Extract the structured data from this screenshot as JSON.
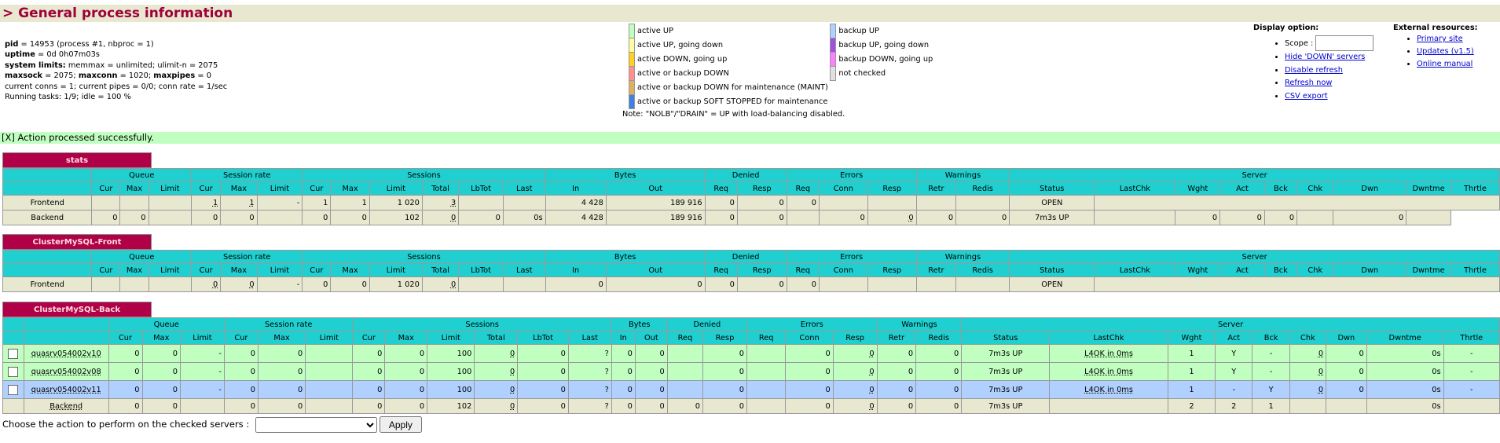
{
  "title": "> General process information",
  "info": {
    "pid_label": "pid",
    "pid_value": " = 14953 (process #1, nbproc = 1)",
    "uptime_label": "uptime",
    "uptime_value": " = 0d 0h07m03s",
    "syslimits_label": "system limits:",
    "syslimits_value": " memmax = unlimited; ulimit-n = 2075",
    "maxsock_label": "maxsock",
    "maxsock_value": " = 2075; ",
    "maxconn_label": "maxconn",
    "maxconn_value": " = 1020; ",
    "maxpipes_label": "maxpipes",
    "maxpipes_value": " = 0",
    "conns": "current conns = 1; current pipes = 0/0; conn rate = 1/sec",
    "tasks": "Running tasks: 1/9; idle = 100 %"
  },
  "legend": {
    "items_left": [
      {
        "color": "#c0ffc0",
        "label": "active UP"
      },
      {
        "color": "#ffffa0",
        "label": "active UP, going down"
      },
      {
        "color": "#ffd020",
        "label": "active DOWN, going up"
      },
      {
        "color": "#ff9090",
        "label": "active or backup DOWN"
      },
      {
        "color": "#e0b060",
        "label": "active or backup DOWN for maintenance (MAINT)"
      },
      {
        "color": "#4080e0",
        "label": "active or backup SOFT STOPPED for maintenance"
      }
    ],
    "items_right": [
      {
        "color": "#b0d0ff",
        "label": "backup UP"
      },
      {
        "color": "#a050e0",
        "label": "backup UP, going down"
      },
      {
        "color": "#ff80ff",
        "label": "backup DOWN, going up"
      },
      {
        "color": "#e0e0e0",
        "label": "not checked"
      }
    ],
    "note": "Note: \"NOLB\"/\"DRAIN\" = UP with load-balancing disabled."
  },
  "display": {
    "title": "Display option:",
    "scope_label": "Scope :",
    "scope_value": "",
    "links": [
      "Hide 'DOWN' servers",
      "Disable refresh",
      "Refresh now",
      "CSV export"
    ]
  },
  "external": {
    "title": "External resources:",
    "links": [
      "Primary site",
      "Updates (v1.5)",
      "Online manual"
    ]
  },
  "success": "[X] Action processed successfully.",
  "headers": {
    "queue": "Queue",
    "session_rate": "Session rate",
    "sessions": "Sessions",
    "bytes": "Bytes",
    "denied": "Denied",
    "errors": "Errors",
    "warnings": "Warnings",
    "server": "Server",
    "cur": "Cur",
    "max": "Max",
    "limit": "Limit",
    "total": "Total",
    "lbtot": "LbTot",
    "last": "Last",
    "in": "In",
    "out": "Out",
    "req": "Req",
    "resp": "Resp",
    "conn": "Conn",
    "retr": "Retr",
    "redis": "Redis",
    "status": "Status",
    "lastchk": "LastChk",
    "wght": "Wght",
    "act": "Act",
    "bck": "Bck",
    "chk": "Chk",
    "dwn": "Dwn",
    "dwntme": "Dwntme",
    "thrtle": "Thrtle"
  },
  "stats": {
    "name": "stats",
    "frontend": {
      "name": "Frontend",
      "sr_cur": "1",
      "sr_max": "1",
      "sr_lim": "-",
      "s_cur": "1",
      "s_max": "1",
      "s_lim": "1 020",
      "s_tot": "3",
      "b_in": "4 428",
      "b_out": "189 916",
      "d_req": "0",
      "d_resp": "0",
      "e_req": "0",
      "status": "OPEN"
    },
    "backend": {
      "name": "Backend",
      "q_cur": "0",
      "q_max": "0",
      "sr_cur": "0",
      "sr_max": "0",
      "s_cur": "0",
      "s_max": "0",
      "s_lim": "102",
      "s_tot": "0",
      "s_lbtot": "0",
      "s_last": "0s",
      "b_in": "4 428",
      "b_out": "189 916",
      "d_req": "0",
      "d_resp": "0",
      "e_conn": "0",
      "e_resp": "0",
      "w_retr": "0",
      "w_redis": "0",
      "status": "7m3s UP",
      "wght": "0",
      "act": "0",
      "bck": "0",
      "dwntme": "0"
    }
  },
  "front": {
    "name": "ClusterMySQL-Front",
    "frontend": {
      "name": "Frontend",
      "sr_cur": "0",
      "sr_max": "0",
      "sr_lim": "-",
      "s_cur": "0",
      "s_max": "0",
      "s_lim": "1 020",
      "s_tot": "0",
      "b_in": "0",
      "b_out": "0",
      "d_req": "0",
      "d_resp": "0",
      "e_req": "0",
      "status": "OPEN"
    }
  },
  "back": {
    "name": "ClusterMySQL-Back",
    "servers": [
      {
        "name": "quasrv054002v10",
        "q_cur": "0",
        "q_max": "0",
        "q_lim": "-",
        "sr_cur": "0",
        "sr_max": "0",
        "s_cur": "0",
        "s_max": "0",
        "s_lim": "100",
        "s_tot": "0",
        "s_lbtot": "0",
        "s_last": "?",
        "b_in": "0",
        "b_out": "0",
        "d_resp": "0",
        "e_conn": "0",
        "e_resp": "0",
        "w_retr": "0",
        "w_redis": "0",
        "status": "7m3s UP",
        "lastchk": "L4OK in 0ms",
        "wght": "1",
        "act": "Y",
        "bck": "-",
        "chk": "0",
        "dwn": "0",
        "dwntme": "0s",
        "thrtle": "-"
      },
      {
        "name": "quasrv054002v08",
        "q_cur": "0",
        "q_max": "0",
        "q_lim": "-",
        "sr_cur": "0",
        "sr_max": "0",
        "s_cur": "0",
        "s_max": "0",
        "s_lim": "100",
        "s_tot": "0",
        "s_lbtot": "0",
        "s_last": "?",
        "b_in": "0",
        "b_out": "0",
        "d_resp": "0",
        "e_conn": "0",
        "e_resp": "0",
        "w_retr": "0",
        "w_redis": "0",
        "status": "7m3s UP",
        "lastchk": "L4OK in 0ms",
        "wght": "1",
        "act": "Y",
        "bck": "-",
        "chk": "0",
        "dwn": "0",
        "dwntme": "0s",
        "thrtle": "-"
      },
      {
        "name": "quasrv054002v11",
        "q_cur": "0",
        "q_max": "0",
        "q_lim": "-",
        "sr_cur": "0",
        "sr_max": "0",
        "s_cur": "0",
        "s_max": "0",
        "s_lim": "100",
        "s_tot": "0",
        "s_lbtot": "0",
        "s_last": "?",
        "b_in": "0",
        "b_out": "0",
        "d_resp": "0",
        "e_conn": "0",
        "e_resp": "0",
        "w_retr": "0",
        "w_redis": "0",
        "status": "7m3s UP",
        "lastchk": "L4OK in 0ms",
        "wght": "1",
        "act": "-",
        "bck": "Y",
        "chk": "0",
        "dwn": "0",
        "dwntme": "0s",
        "thrtle": "-"
      }
    ],
    "backend": {
      "name": "Backend",
      "q_cur": "0",
      "q_max": "0",
      "sr_cur": "0",
      "sr_max": "0",
      "s_cur": "0",
      "s_max": "0",
      "s_lim": "102",
      "s_tot": "0",
      "s_lbtot": "0",
      "s_last": "?",
      "b_in": "0",
      "b_out": "0",
      "d_req": "0",
      "d_resp": "0",
      "e_conn": "0",
      "e_resp": "0",
      "w_retr": "0",
      "w_redis": "0",
      "status": "7m3s UP",
      "wght": "2",
      "act": "2",
      "bck": "1",
      "dwntme": "0s"
    }
  },
  "action": {
    "label": "Choose the action to perform on the checked servers : ",
    "selected": "",
    "apply": "Apply"
  }
}
